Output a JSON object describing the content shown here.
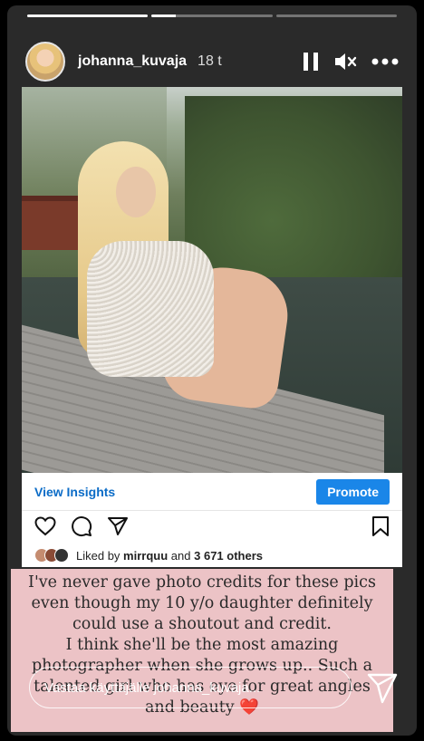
{
  "header": {
    "username": "johanna_kuvaja",
    "time": "18 t",
    "icons": [
      "pause-icon",
      "mute-icon",
      "more-icon"
    ]
  },
  "progress": {
    "segments": 3,
    "current": 2
  },
  "post": {
    "view_insights": "View Insights",
    "promote": "Promote",
    "liked_by_prefix": "Liked by",
    "liked_by_user": "mirrquu",
    "liked_by_and": "and",
    "liked_by_count": "3 671 others",
    "action_icons": [
      "heart-icon",
      "comment-icon",
      "share-icon",
      "bookmark-icon"
    ]
  },
  "caption": {
    "line1": "I've never gave photo credits for these pics",
    "line2": "even though my 10 y/o daughter definitely",
    "line3": "could use a shoutout and credit.",
    "line4": "I think she'll be the most amazing",
    "line5": "photographer when she grows up.. Such a",
    "line6": "talented girl who has eye for great angles",
    "line7": "and beauty",
    "heart": "❤️"
  },
  "reply": {
    "placeholder": "Vastaa käyttäjälle johanna_kuvaja..."
  },
  "colors": {
    "accent_blue": "#1a86e8",
    "caption_bg": "#ecc3c6"
  }
}
